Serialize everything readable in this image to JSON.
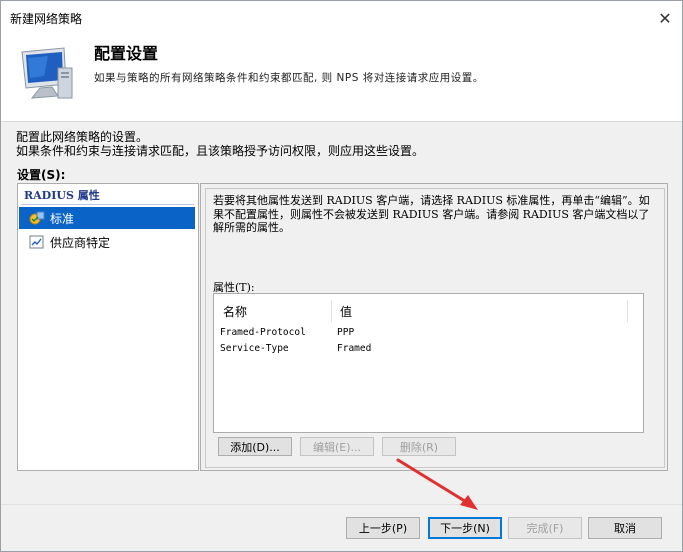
{
  "window": {
    "title": "新建网络策略",
    "close_glyph": "✕"
  },
  "header": {
    "title": "配置设置",
    "subtitle": "如果与策略的所有网络策略条件和约束都匹配, 则 NPS 将对连接请求应用设置。",
    "icon": "monitor-computer-icon"
  },
  "description": {
    "line1": "配置此网络策略的设置。",
    "line2": "如果条件和约束与连接请求匹配，且该策略授予访问权限，则应用这些设置。"
  },
  "settings_label": "设置(S):",
  "tree": {
    "header": "RADIUS 属性",
    "items": [
      {
        "label": "标准",
        "icon": "standard-attributes-icon",
        "selected": true
      },
      {
        "label": "供应商特定",
        "icon": "vendor-specific-icon",
        "selected": false
      }
    ]
  },
  "right_panel": {
    "info": "若要将其他属性发送到 RADIUS 客户端，请选择 RADIUS 标准属性，再单击“编辑”。如果不配置属性，则属性不会被发送到 RADIUS 客户端。请参阅 RADIUS 客户端文档以了解所需的属性。",
    "attributes_label": "属性(T):",
    "table": {
      "columns": [
        "名称",
        "值"
      ],
      "rows": [
        {
          "name": "Framed-Protocol",
          "value": "PPP"
        },
        {
          "name": "Service-Type",
          "value": "Framed"
        }
      ]
    },
    "buttons": {
      "add": "添加(D)...",
      "edit": "编辑(E)...",
      "delete": "删除(R)"
    }
  },
  "footer": {
    "back": "上一步(P)",
    "next": "下一步(N)",
    "finish": "完成(F)",
    "cancel": "取消"
  },
  "colors": {
    "selection": "#0a64c8",
    "annotation_arrow": "#e03030",
    "default_button_border": "#0078d7"
  }
}
